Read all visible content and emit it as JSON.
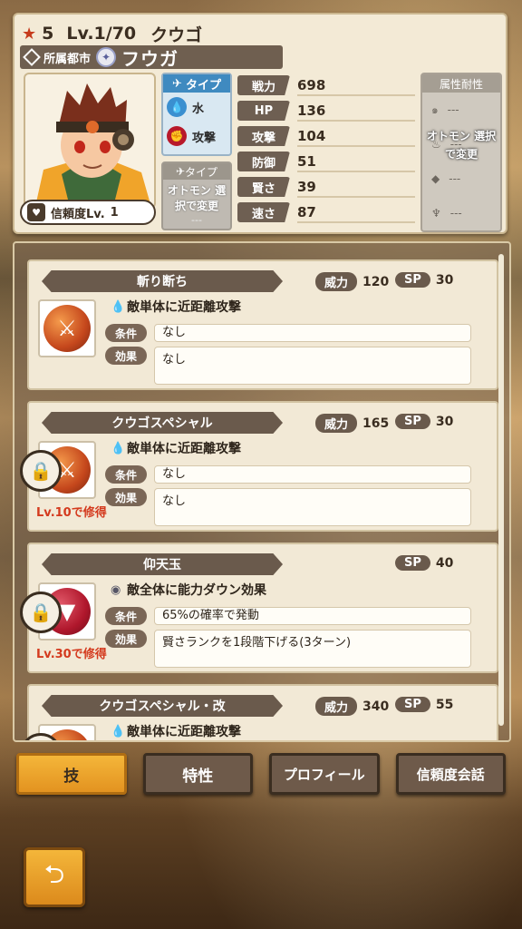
{
  "header": {
    "rarity": "5",
    "level": "Lv.1/70",
    "monster_name": "クウゴ",
    "city_label": "所属都市",
    "character_name": "フウガ",
    "trust_label": "信頼度Lv.",
    "trust_level": "1"
  },
  "type": {
    "heading": "タイプ",
    "element": "水",
    "attack_kind": "攻撃"
  },
  "otomon": {
    "heading": "タイプ",
    "placeholder": "---",
    "overlay": "オトモン 選択で変更"
  },
  "stats": [
    {
      "label": "戦力",
      "value": "698"
    },
    {
      "label": "HP",
      "value": "136"
    },
    {
      "label": "攻撃",
      "value": "104"
    },
    {
      "label": "防御",
      "value": "51"
    },
    {
      "label": "賢さ",
      "value": "39"
    },
    {
      "label": "速さ",
      "value": "87"
    }
  ],
  "resist": {
    "heading": "属性耐性",
    "rows": [
      "---",
      "---",
      "---",
      "---"
    ],
    "overlay": "オトモン 選択で変更"
  },
  "skills": [
    {
      "name": "斬り断ち",
      "power_label": "威力",
      "power": "120",
      "sp_label": "SP",
      "sp": "30",
      "desc": "敵単体に近距離攻撃",
      "cond_label": "条件",
      "cond": "なし",
      "eff_label": "効果",
      "eff": "なし",
      "learn": ""
    },
    {
      "name": "クウゴスペシャル",
      "power_label": "威力",
      "power": "165",
      "sp_label": "SP",
      "sp": "30",
      "desc": "敵単体に近距離攻撃",
      "cond_label": "条件",
      "cond": "なし",
      "eff_label": "効果",
      "eff": "なし",
      "learn": "Lv.10で修得"
    },
    {
      "name": "仰天玉",
      "power_label": "",
      "power": "",
      "sp_label": "SP",
      "sp": "40",
      "desc": "敵全体に能力ダウン効果",
      "cond_label": "条件",
      "cond": "65%の確率で発動",
      "eff_label": "効果",
      "eff": "賢さランクを1段階下げる(3ターン)",
      "learn": "Lv.30で修得"
    },
    {
      "name": "クウゴスペシャル・改",
      "power_label": "威力",
      "power": "340",
      "sp_label": "SP",
      "sp": "55",
      "desc": "敵単体に近距離攻撃",
      "cond_label": "",
      "cond": "",
      "eff_label": "",
      "eff": "",
      "learn": ""
    }
  ],
  "tabs": [
    "技",
    "特性",
    "プロフィール",
    "信頼度会話"
  ],
  "colors": {
    "accent": "#f4b63a",
    "learn_red": "#d43a1e",
    "label_brown": "#6a5a4c"
  }
}
